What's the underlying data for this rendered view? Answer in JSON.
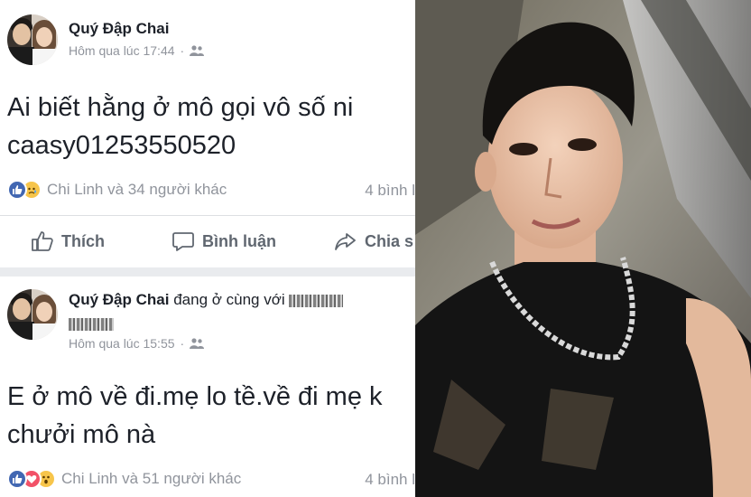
{
  "posts": [
    {
      "author": "Quý Đập Chai",
      "with_text": "",
      "time": "Hôm qua lúc 17:44",
      "privacy_icon": "friends-icon",
      "text_lines": [
        "Ai biết hằng ở mô gọi vô số ni",
        "caasy01253550520"
      ],
      "reaction_icons": [
        "like-icon",
        "sad-icon"
      ],
      "reaction_names": "Chi Linh và 34 người khác",
      "comments": "4 bình l",
      "actions": {
        "like": "Thích",
        "comment": "Bình luận",
        "share": "Chia s"
      }
    },
    {
      "author": "Quý Đập Chai",
      "with_text": "đang ở cùng với",
      "time": "Hôm qua lúc 15:55",
      "privacy_icon": "friends-icon",
      "text_lines": [
        "E ở mô về đi.mẹ lo tề.về đi mẹ k",
        "chưởi mô nà"
      ],
      "reaction_icons": [
        "like-icon",
        "love-icon",
        "wow-icon"
      ],
      "reaction_names": "Chi Linh và 51 người khác",
      "comments": "4 bình l"
    }
  ],
  "photo": {
    "description_icon": "person-photo"
  },
  "colors": {
    "facebook_blue": "#4267b2",
    "text": "#1d2129",
    "muted": "#90949c",
    "divider": "#dddfe2"
  }
}
